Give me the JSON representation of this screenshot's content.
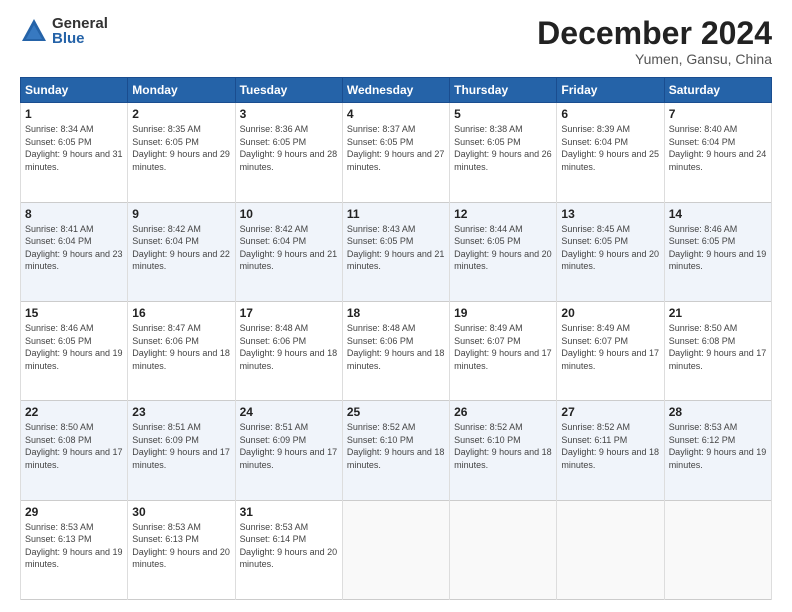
{
  "logo": {
    "general": "General",
    "blue": "Blue"
  },
  "title": "December 2024",
  "location": "Yumen, Gansu, China",
  "weekdays": [
    "Sunday",
    "Monday",
    "Tuesday",
    "Wednesday",
    "Thursday",
    "Friday",
    "Saturday"
  ],
  "weeks": [
    [
      {
        "day": "1",
        "sunrise": "8:34 AM",
        "sunset": "6:05 PM",
        "daylight": "9 hours and 31 minutes."
      },
      {
        "day": "2",
        "sunrise": "8:35 AM",
        "sunset": "6:05 PM",
        "daylight": "9 hours and 29 minutes."
      },
      {
        "day": "3",
        "sunrise": "8:36 AM",
        "sunset": "6:05 PM",
        "daylight": "9 hours and 28 minutes."
      },
      {
        "day": "4",
        "sunrise": "8:37 AM",
        "sunset": "6:05 PM",
        "daylight": "9 hours and 27 minutes."
      },
      {
        "day": "5",
        "sunrise": "8:38 AM",
        "sunset": "6:05 PM",
        "daylight": "9 hours and 26 minutes."
      },
      {
        "day": "6",
        "sunrise": "8:39 AM",
        "sunset": "6:04 PM",
        "daylight": "9 hours and 25 minutes."
      },
      {
        "day": "7",
        "sunrise": "8:40 AM",
        "sunset": "6:04 PM",
        "daylight": "9 hours and 24 minutes."
      }
    ],
    [
      {
        "day": "8",
        "sunrise": "8:41 AM",
        "sunset": "6:04 PM",
        "daylight": "9 hours and 23 minutes."
      },
      {
        "day": "9",
        "sunrise": "8:42 AM",
        "sunset": "6:04 PM",
        "daylight": "9 hours and 22 minutes."
      },
      {
        "day": "10",
        "sunrise": "8:42 AM",
        "sunset": "6:04 PM",
        "daylight": "9 hours and 21 minutes."
      },
      {
        "day": "11",
        "sunrise": "8:43 AM",
        "sunset": "6:05 PM",
        "daylight": "9 hours and 21 minutes."
      },
      {
        "day": "12",
        "sunrise": "8:44 AM",
        "sunset": "6:05 PM",
        "daylight": "9 hours and 20 minutes."
      },
      {
        "day": "13",
        "sunrise": "8:45 AM",
        "sunset": "6:05 PM",
        "daylight": "9 hours and 20 minutes."
      },
      {
        "day": "14",
        "sunrise": "8:46 AM",
        "sunset": "6:05 PM",
        "daylight": "9 hours and 19 minutes."
      }
    ],
    [
      {
        "day": "15",
        "sunrise": "8:46 AM",
        "sunset": "6:05 PM",
        "daylight": "9 hours and 19 minutes."
      },
      {
        "day": "16",
        "sunrise": "8:47 AM",
        "sunset": "6:06 PM",
        "daylight": "9 hours and 18 minutes."
      },
      {
        "day": "17",
        "sunrise": "8:48 AM",
        "sunset": "6:06 PM",
        "daylight": "9 hours and 18 minutes."
      },
      {
        "day": "18",
        "sunrise": "8:48 AM",
        "sunset": "6:06 PM",
        "daylight": "9 hours and 18 minutes."
      },
      {
        "day": "19",
        "sunrise": "8:49 AM",
        "sunset": "6:07 PM",
        "daylight": "9 hours and 17 minutes."
      },
      {
        "day": "20",
        "sunrise": "8:49 AM",
        "sunset": "6:07 PM",
        "daylight": "9 hours and 17 minutes."
      },
      {
        "day": "21",
        "sunrise": "8:50 AM",
        "sunset": "6:08 PM",
        "daylight": "9 hours and 17 minutes."
      }
    ],
    [
      {
        "day": "22",
        "sunrise": "8:50 AM",
        "sunset": "6:08 PM",
        "daylight": "9 hours and 17 minutes."
      },
      {
        "day": "23",
        "sunrise": "8:51 AM",
        "sunset": "6:09 PM",
        "daylight": "9 hours and 17 minutes."
      },
      {
        "day": "24",
        "sunrise": "8:51 AM",
        "sunset": "6:09 PM",
        "daylight": "9 hours and 17 minutes."
      },
      {
        "day": "25",
        "sunrise": "8:52 AM",
        "sunset": "6:10 PM",
        "daylight": "9 hours and 18 minutes."
      },
      {
        "day": "26",
        "sunrise": "8:52 AM",
        "sunset": "6:10 PM",
        "daylight": "9 hours and 18 minutes."
      },
      {
        "day": "27",
        "sunrise": "8:52 AM",
        "sunset": "6:11 PM",
        "daylight": "9 hours and 18 minutes."
      },
      {
        "day": "28",
        "sunrise": "8:53 AM",
        "sunset": "6:12 PM",
        "daylight": "9 hours and 19 minutes."
      }
    ],
    [
      {
        "day": "29",
        "sunrise": "8:53 AM",
        "sunset": "6:13 PM",
        "daylight": "9 hours and 19 minutes."
      },
      {
        "day": "30",
        "sunrise": "8:53 AM",
        "sunset": "6:13 PM",
        "daylight": "9 hours and 20 minutes."
      },
      {
        "day": "31",
        "sunrise": "8:53 AM",
        "sunset": "6:14 PM",
        "daylight": "9 hours and 20 minutes."
      },
      null,
      null,
      null,
      null
    ]
  ]
}
